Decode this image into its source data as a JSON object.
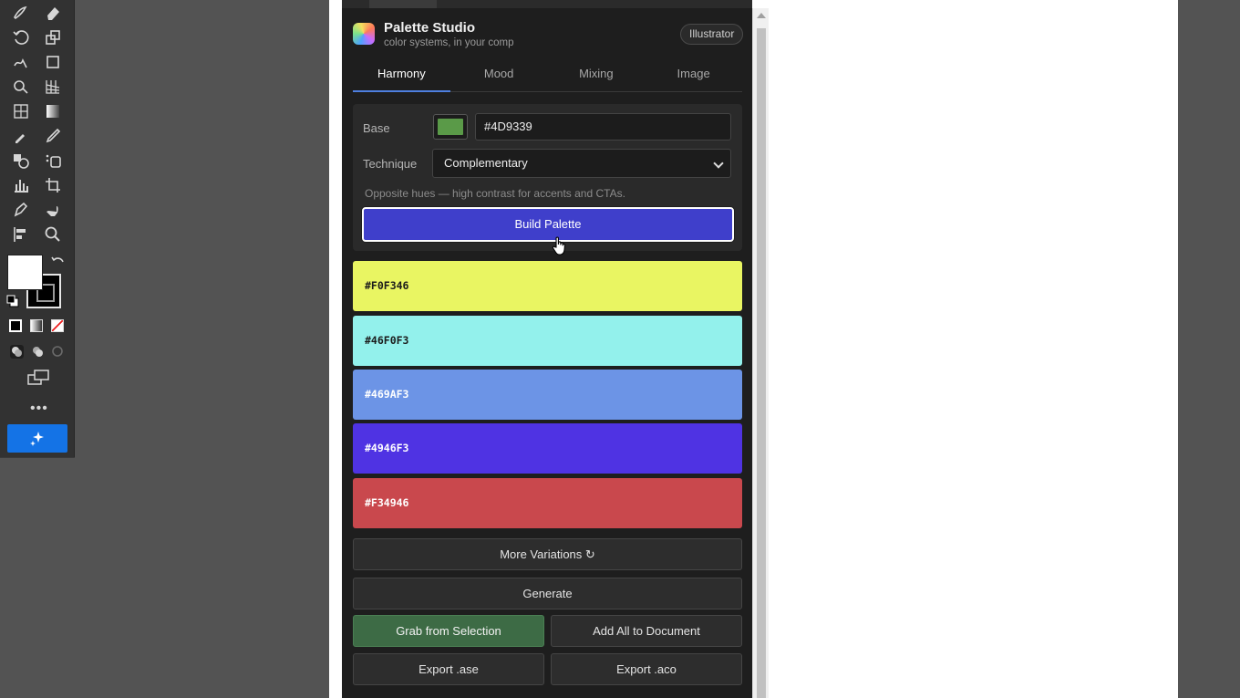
{
  "toolbar": {
    "tools": [
      "pencil-icon",
      "eraser-icon",
      "rotate-icon",
      "scale-icon",
      "warp-icon",
      "free-transform-icon",
      "shape-builder-icon",
      "perspective-grid-icon",
      "mesh-icon",
      "gradient-icon",
      "eyedropper-icon",
      "measure-icon",
      "blend-icon",
      "symbol-sprayer-icon",
      "column-graph-icon",
      "artboard-icon",
      "pen-icon",
      "hand-icon",
      "align-icon",
      "zoom-icon"
    ],
    "more_label": "•••"
  },
  "panel": {
    "app_title": "Palette Studio",
    "app_subtitle": "color systems, in your comp",
    "host_badge": "Illustrator",
    "tabs": [
      {
        "label": "Harmony",
        "active": true
      },
      {
        "label": "Mood",
        "active": false
      },
      {
        "label": "Mixing",
        "active": false
      },
      {
        "label": "Image",
        "active": false
      }
    ],
    "base_label": "Base",
    "base_color": "#5a9a48",
    "base_hex": "#4D9339",
    "technique_label": "Technique",
    "technique_value": "Complementary",
    "hint": "Opposite hues — high contrast for accents and CTAs.",
    "build_button": "Build Palette",
    "swatches": [
      {
        "hex": "#F0F346",
        "color": "#e9f562",
        "text_color": "#1b1b1b"
      },
      {
        "hex": "#46F0F3",
        "color": "#93f1ec",
        "text_color": "#1b1b1b"
      },
      {
        "hex": "#469AF3",
        "color": "#6c94e6",
        "text_color": "#ffffff"
      },
      {
        "hex": "#4946F3",
        "color": "#4f33e3",
        "text_color": "#ffffff"
      },
      {
        "hex": "#F34946",
        "color": "#c9484d",
        "text_color": "#ffffff"
      }
    ],
    "more_variations": "More Variations ↻",
    "generate": "Generate",
    "grab_selection": "Grab from Selection",
    "add_all": "Add All to Document",
    "export_ase": "Export .ase",
    "export_aco": "Export .aco"
  }
}
